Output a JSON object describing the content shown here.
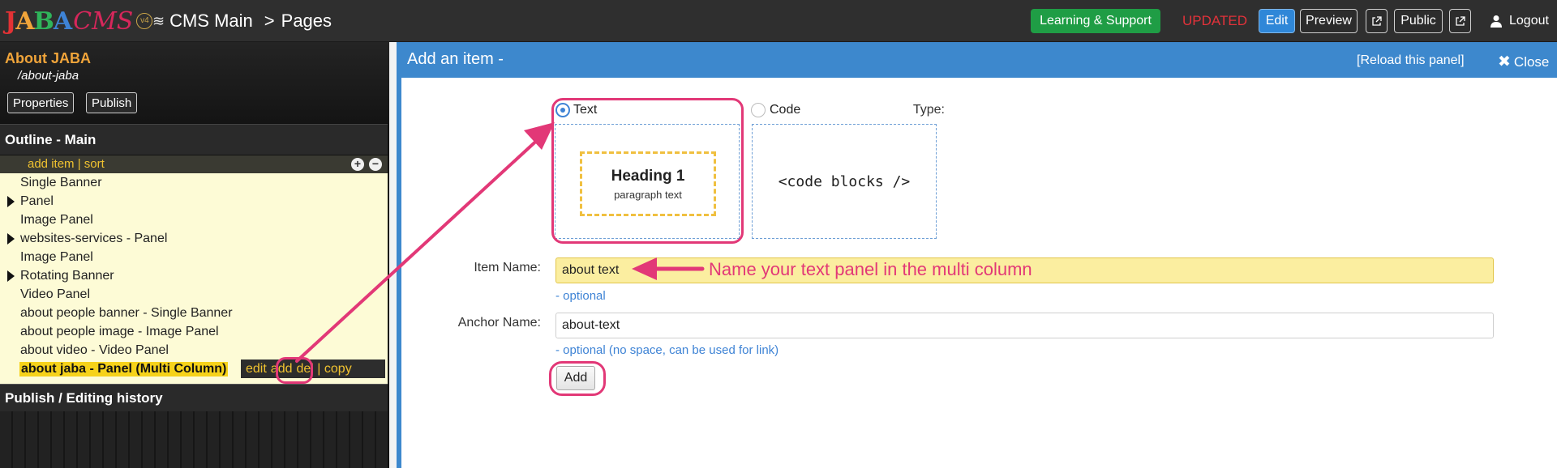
{
  "topbar": {
    "logo_letters": [
      "J",
      "A",
      "B",
      "A"
    ],
    "logo_colors": [
      "#e23235",
      "#f0a43a",
      "#2fb45a",
      "#3e83d5"
    ],
    "logo_cms": "CMS",
    "logo_version": "v4",
    "crumb_root": "CMS Main",
    "crumb_sep": ">",
    "crumb_current": "Pages",
    "learning": "Learning & Support",
    "status": "UPDATED",
    "edit": "Edit",
    "preview": "Preview",
    "public": "Public",
    "logout": "Logout"
  },
  "sidebar": {
    "page_title": "About JABA",
    "page_slug": "/about-jaba",
    "properties": "Properties",
    "publish": "Publish",
    "outline_title": "Outline - Main",
    "toolbar_text": "add item | sort",
    "items": [
      {
        "label": "Single Banner",
        "expandable": false
      },
      {
        "label": "Panel",
        "expandable": true
      },
      {
        "label": "Image Panel",
        "expandable": false
      },
      {
        "label": "websites-services - Panel",
        "expandable": true
      },
      {
        "label": "Image Panel",
        "expandable": false
      },
      {
        "label": "Rotating Banner",
        "expandable": true
      },
      {
        "label": "Video Panel",
        "expandable": false
      },
      {
        "label": "about people banner - Single Banner",
        "expandable": false
      },
      {
        "label": "about people image - Image Panel",
        "expandable": false
      },
      {
        "label": "about video - Video Panel",
        "expandable": false
      },
      {
        "label": "about jaba - Panel (Multi Column)",
        "expandable": false
      }
    ],
    "selected_actions": {
      "edit": "edit",
      "add": "add",
      "del_copy": "del | copy"
    },
    "history_title": "Publish / Editing history"
  },
  "panel": {
    "title": "Add an item -",
    "reload": "[Reload this panel]",
    "close": "Close",
    "type_label": "Type:",
    "type_text": "Text",
    "type_code": "Code",
    "preview_heading": "Heading 1",
    "preview_paragraph": "paragraph text",
    "preview_code": "<code blocks />",
    "item_name_label": "Item Name:",
    "item_name_value": "about text",
    "item_name_hint": "- optional",
    "anchor_label": "Anchor Name:",
    "anchor_value": "about-text",
    "anchor_hint": "- optional (no space, can be used for link)",
    "add_button": "Add"
  },
  "annotation": {
    "callout": "Name your text panel in the multi column",
    "color": "#e23877"
  }
}
